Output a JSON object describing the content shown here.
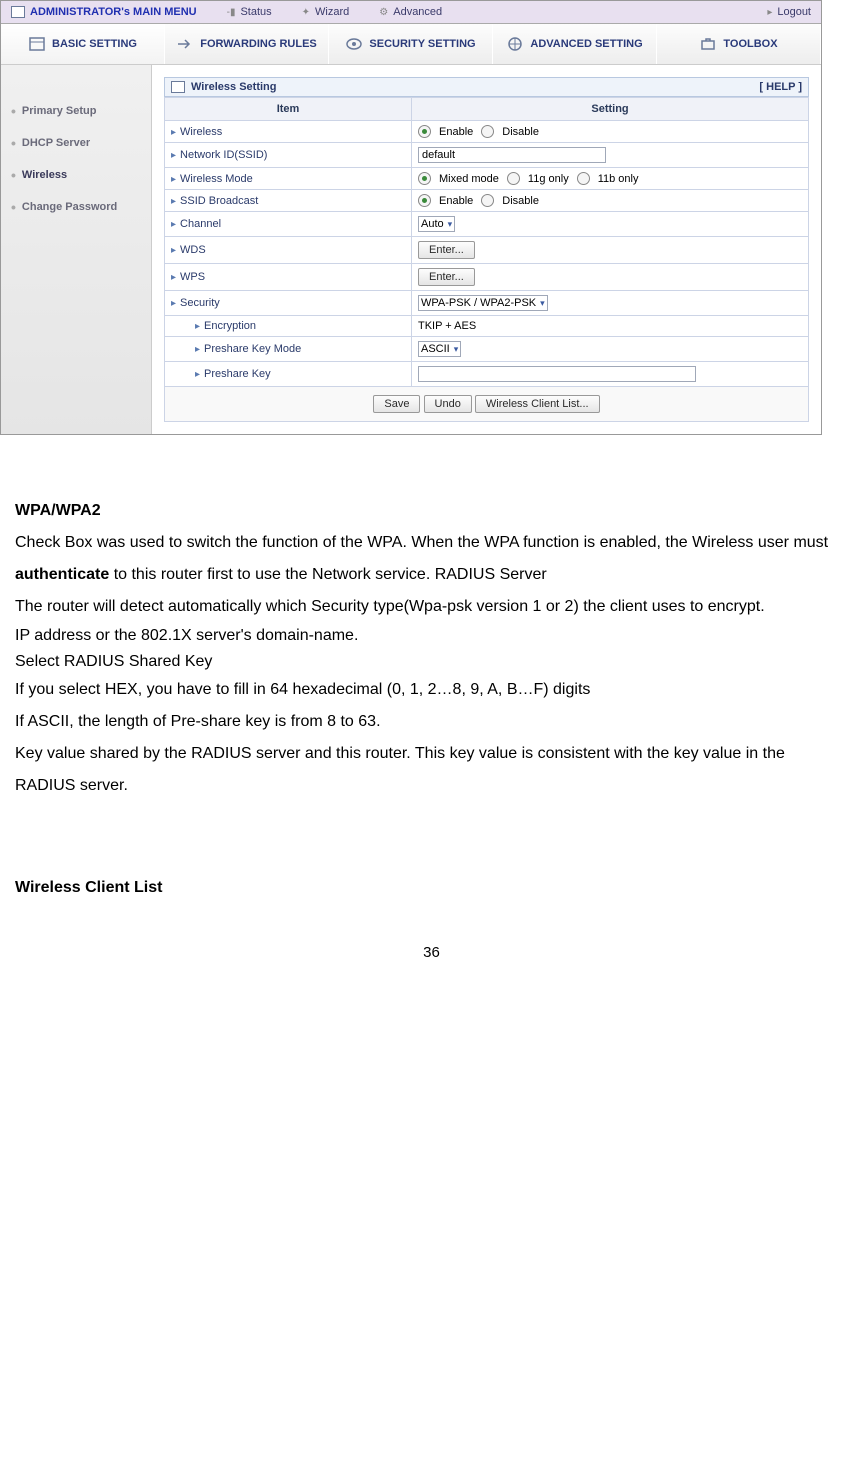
{
  "topbar": {
    "title": "ADMINISTRATOR's MAIN MENU",
    "items": [
      "Status",
      "Wizard",
      "Advanced"
    ],
    "logout": "Logout"
  },
  "tabs": [
    "BASIC SETTING",
    "FORWARDING RULES",
    "SECURITY SETTING",
    "ADVANCED SETTING",
    "TOOLBOX"
  ],
  "sidebar": {
    "items": [
      "Primary Setup",
      "DHCP Server",
      "Wireless",
      "Change Password"
    ],
    "active_index": 2
  },
  "panel": {
    "title": "Wireless Setting",
    "help": "[ HELP ]",
    "headers": {
      "item": "Item",
      "setting": "Setting"
    }
  },
  "rows": {
    "wireless": {
      "label": "Wireless",
      "opts": [
        "Enable",
        "Disable"
      ],
      "selected": 0
    },
    "ssid": {
      "label": "Network ID(SSID)",
      "value": "default"
    },
    "mode": {
      "label": "Wireless Mode",
      "opts": [
        "Mixed mode",
        "11g only",
        "11b only"
      ],
      "selected": 0
    },
    "broadcast": {
      "label": "SSID Broadcast",
      "opts": [
        "Enable",
        "Disable"
      ],
      "selected": 0
    },
    "channel": {
      "label": "Channel",
      "value": "Auto"
    },
    "wds": {
      "label": "WDS",
      "btn": "Enter..."
    },
    "wps": {
      "label": "WPS",
      "btn": "Enter..."
    },
    "security": {
      "label": "Security",
      "value": "WPA-PSK / WPA2-PSK"
    },
    "encryption": {
      "label": "Encryption",
      "value": "TKIP + AES"
    },
    "pskmode": {
      "label": "Preshare Key Mode",
      "value": "ASCII"
    },
    "psk": {
      "label": "Preshare Key",
      "value": ""
    }
  },
  "buttons": {
    "save": "Save",
    "undo": "Undo",
    "clients": "Wireless Client List..."
  },
  "doc": {
    "h1": "WPA/WPA2",
    "p1a": "Check Box was used to switch the function of the WPA. When the WPA function is enabled, the Wireless user must ",
    "p1b": "authenticate",
    "p1c": " to this router first to use the Network service. RADIUS Server",
    "p2": "The router will detect automatically    which Security type(Wpa-psk version 1 or 2) the client uses to encrypt.",
    "p3": "IP address or the 802.1X server's domain-name.",
    "p4": "Select RADIUS Shared Key",
    "p5": "If you select HEX, you have to fill in 64 hexadecimal (0, 1, 2…8, 9, A, B…F) digits",
    "p6": "If ASCII, the length of Pre-share key is from 8 to 63.",
    "p7": "Key value shared by the RADIUS server and this router. This key value is consistent with the key value in the RADIUS server.",
    "h2": "Wireless Client List"
  },
  "page_number": "36"
}
